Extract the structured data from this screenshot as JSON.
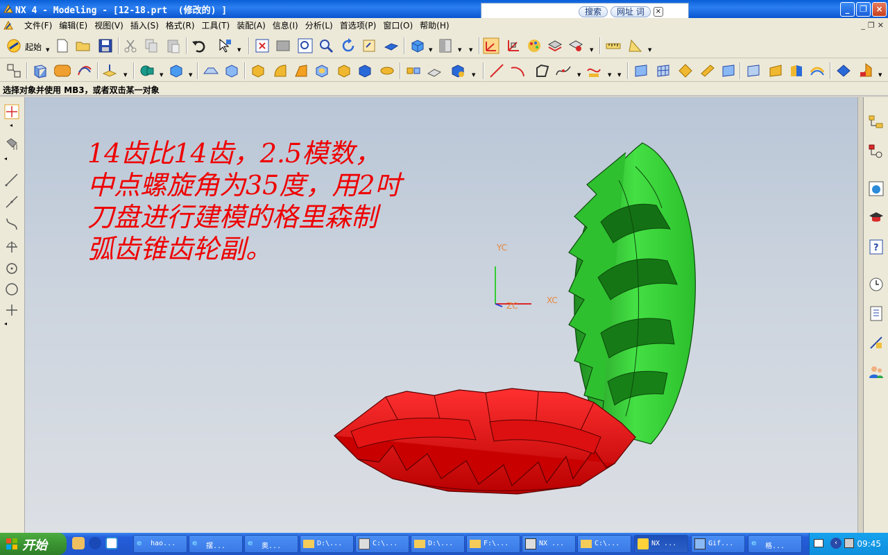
{
  "window": {
    "title": "NX 4 - Modeling - [12-18.prt  (修改的) ]"
  },
  "searchbar": {
    "tab_search": "搜索",
    "tab_url": "网址 词",
    "close": "×"
  },
  "menubar": {
    "items": [
      "文件(F)",
      "编辑(E)",
      "视图(V)",
      "插入(S)",
      "格式(R)",
      "工具(T)",
      "装配(A)",
      "信息(I)",
      "分析(L)",
      "首选项(P)",
      "窗口(O)",
      "帮助(H)"
    ]
  },
  "toolbar": {
    "start_label": "起始"
  },
  "prompt": {
    "text": "选择对象并使用 MB3，或者双击某一对象"
  },
  "viewport": {
    "caption_lines": [
      "14齿比14齿，2.5模数，",
      "中点螺旋角为35度，用2吋",
      "刀盘进行建模的格里森制",
      "弧齿锥齿轮副。"
    ],
    "axis": {
      "yc": "YC",
      "xc": "XC",
      "zc": "ZC"
    },
    "colors": {
      "gear_green": "#33dd33",
      "gear_red": "#ee0000",
      "caption": "#ee0000"
    }
  },
  "taskbar": {
    "start_label": "开始",
    "tasks": [
      {
        "label": "hao...",
        "icon": "ie-icon"
      },
      {
        "label": "摆...",
        "icon": "ie-icon"
      },
      {
        "label": "奥...",
        "icon": "ie-icon"
      },
      {
        "label": "D:\\...",
        "icon": "folder-icon"
      },
      {
        "label": "C:\\...",
        "icon": "explorer-icon"
      },
      {
        "label": "D:\\...",
        "icon": "folder-icon"
      },
      {
        "label": "F:\\...",
        "icon": "folder-icon"
      },
      {
        "label": "NX ...",
        "icon": "nx-icon"
      },
      {
        "label": "C:\\...",
        "icon": "folder-icon"
      },
      {
        "label": "NX ...",
        "icon": "nx-icon",
        "active": true
      },
      {
        "label": "Gif...",
        "icon": "gif-icon"
      },
      {
        "label": "格...",
        "icon": "ie-icon"
      }
    ],
    "clock": "09:45"
  }
}
